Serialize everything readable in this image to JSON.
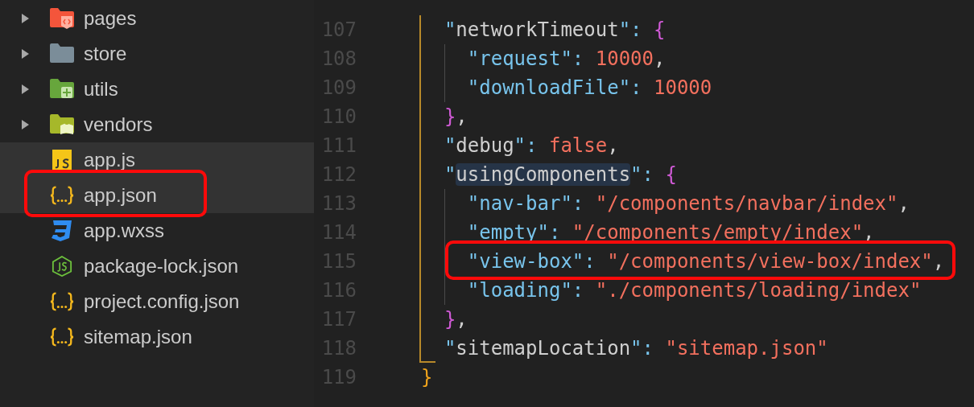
{
  "sidebar": {
    "items": [
      {
        "label": "pages",
        "kind": "folder",
        "expanded": false,
        "selected": false,
        "annotated": false
      },
      {
        "label": "store",
        "kind": "folder",
        "expanded": false,
        "selected": false,
        "annotated": false
      },
      {
        "label": "utils",
        "kind": "folder",
        "expanded": false,
        "selected": false,
        "annotated": false
      },
      {
        "label": "vendors",
        "kind": "folder",
        "expanded": false,
        "selected": false,
        "annotated": false
      },
      {
        "label": "app.js",
        "kind": "file",
        "selected": true,
        "annotated": false
      },
      {
        "label": "app.json",
        "kind": "file",
        "selected": true,
        "annotated": true
      },
      {
        "label": "app.wxss",
        "kind": "file",
        "selected": false,
        "annotated": false
      },
      {
        "label": "package-lock.json",
        "kind": "file",
        "selected": false,
        "annotated": false
      },
      {
        "label": "project.config.json",
        "kind": "file",
        "selected": false,
        "annotated": false
      },
      {
        "label": "sitemap.json",
        "kind": "file",
        "selected": false,
        "annotated": false
      }
    ]
  },
  "editor": {
    "lines": [
      {
        "n": "107",
        "annotated": false,
        "tokens": [
          {
            "text": "  \"",
            "kind": "q"
          },
          {
            "text": "networkTimeout",
            "kind": "key"
          },
          {
            "text": "\": ",
            "kind": "q"
          },
          {
            "text": "{",
            "kind": "brace"
          }
        ]
      },
      {
        "n": "108",
        "annotated": false,
        "tokens": [
          {
            "text": "    \"request\": ",
            "kind": "prop"
          },
          {
            "text": "10000",
            "kind": "num"
          },
          {
            "text": ",",
            "kind": "p"
          }
        ]
      },
      {
        "n": "109",
        "annotated": false,
        "tokens": [
          {
            "text": "    \"downloadFile\": ",
            "kind": "prop"
          },
          {
            "text": "10000",
            "kind": "num"
          }
        ]
      },
      {
        "n": "110",
        "annotated": false,
        "tokens": [
          {
            "text": "  }",
            "kind": "brace"
          },
          {
            "text": ",",
            "kind": "p"
          }
        ]
      },
      {
        "n": "111",
        "annotated": false,
        "tokens": [
          {
            "text": "  \"",
            "kind": "q"
          },
          {
            "text": "debug",
            "kind": "key"
          },
          {
            "text": "\": ",
            "kind": "q"
          },
          {
            "text": "false",
            "kind": "bool"
          },
          {
            "text": ",",
            "kind": "p"
          }
        ]
      },
      {
        "n": "112",
        "annotated": false,
        "tokens": [
          {
            "text": "  \"",
            "kind": "q"
          },
          {
            "text": "usingComponents",
            "kind": "keyhl"
          },
          {
            "text": "\": ",
            "kind": "q"
          },
          {
            "text": "{",
            "kind": "brace"
          }
        ]
      },
      {
        "n": "113",
        "annotated": false,
        "tokens": [
          {
            "text": "    \"nav-bar\": ",
            "kind": "prop"
          },
          {
            "text": "\"/components/navbar/index\"",
            "kind": "str"
          },
          {
            "text": ",",
            "kind": "p"
          }
        ]
      },
      {
        "n": "114",
        "annotated": false,
        "tokens": [
          {
            "text": "    \"empty\": ",
            "kind": "prop"
          },
          {
            "text": "\"/components/empty/index\"",
            "kind": "str"
          },
          {
            "text": ",",
            "kind": "p"
          }
        ]
      },
      {
        "n": "115",
        "annotated": true,
        "tokens": [
          {
            "text": "    \"view-box\": ",
            "kind": "prop"
          },
          {
            "text": "\"/components/view-box/index\"",
            "kind": "str"
          },
          {
            "text": ",",
            "kind": "p"
          }
        ]
      },
      {
        "n": "116",
        "annotated": false,
        "tokens": [
          {
            "text": "    \"loading\": ",
            "kind": "prop"
          },
          {
            "text": "\"./components/loading/index\"",
            "kind": "str"
          }
        ]
      },
      {
        "n": "117",
        "annotated": false,
        "tokens": [
          {
            "text": "  }",
            "kind": "brace"
          },
          {
            "text": ",",
            "kind": "p"
          }
        ]
      },
      {
        "n": "118",
        "annotated": false,
        "tokens": [
          {
            "text": "  \"",
            "kind": "q"
          },
          {
            "text": "sitemapLocation",
            "kind": "key"
          },
          {
            "text": "\": ",
            "kind": "q"
          },
          {
            "text": "\"sitemap.json\"",
            "kind": "str"
          }
        ]
      },
      {
        "n": "119",
        "annotated": false,
        "tokens": [
          {
            "text": "}",
            "kind": "rbrace"
          }
        ]
      }
    ]
  }
}
